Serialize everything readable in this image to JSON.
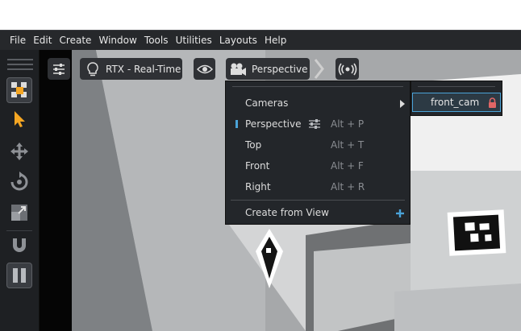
{
  "menubar": {
    "items": [
      "File",
      "Edit",
      "Create",
      "Window",
      "Tools",
      "Utilities",
      "Layouts",
      "Help"
    ]
  },
  "viewport_toolbar": {
    "settings_icon": "sliders-icon",
    "renderer_icon": "lightbulb-icon",
    "renderer_label": "RTX - Real-Time",
    "visibility_icon": "eye-icon",
    "camera_icon": "movie-camera-icon",
    "camera_label": "Perspective",
    "broadcast_icon": "broadcast-icon"
  },
  "camera_menu": {
    "cameras_label": "Cameras",
    "items": [
      {
        "label": "Perspective",
        "shortcut": "Alt + P",
        "selected": true
      },
      {
        "label": "Top",
        "shortcut": "Alt + T",
        "selected": false
      },
      {
        "label": "Front",
        "shortcut": "Alt + F",
        "selected": false
      },
      {
        "label": "Right",
        "shortcut": "Alt + R",
        "selected": false
      }
    ],
    "create_label": "Create from View",
    "create_icon": "plus-icon"
  },
  "cameras_submenu": {
    "item": "front_cam",
    "lock_icon": "lock-icon"
  },
  "colors": {
    "accent": "#4aa3d8",
    "menu_bg": "#23262a",
    "lock": "#e06666",
    "select_tool": "#f5a623"
  }
}
